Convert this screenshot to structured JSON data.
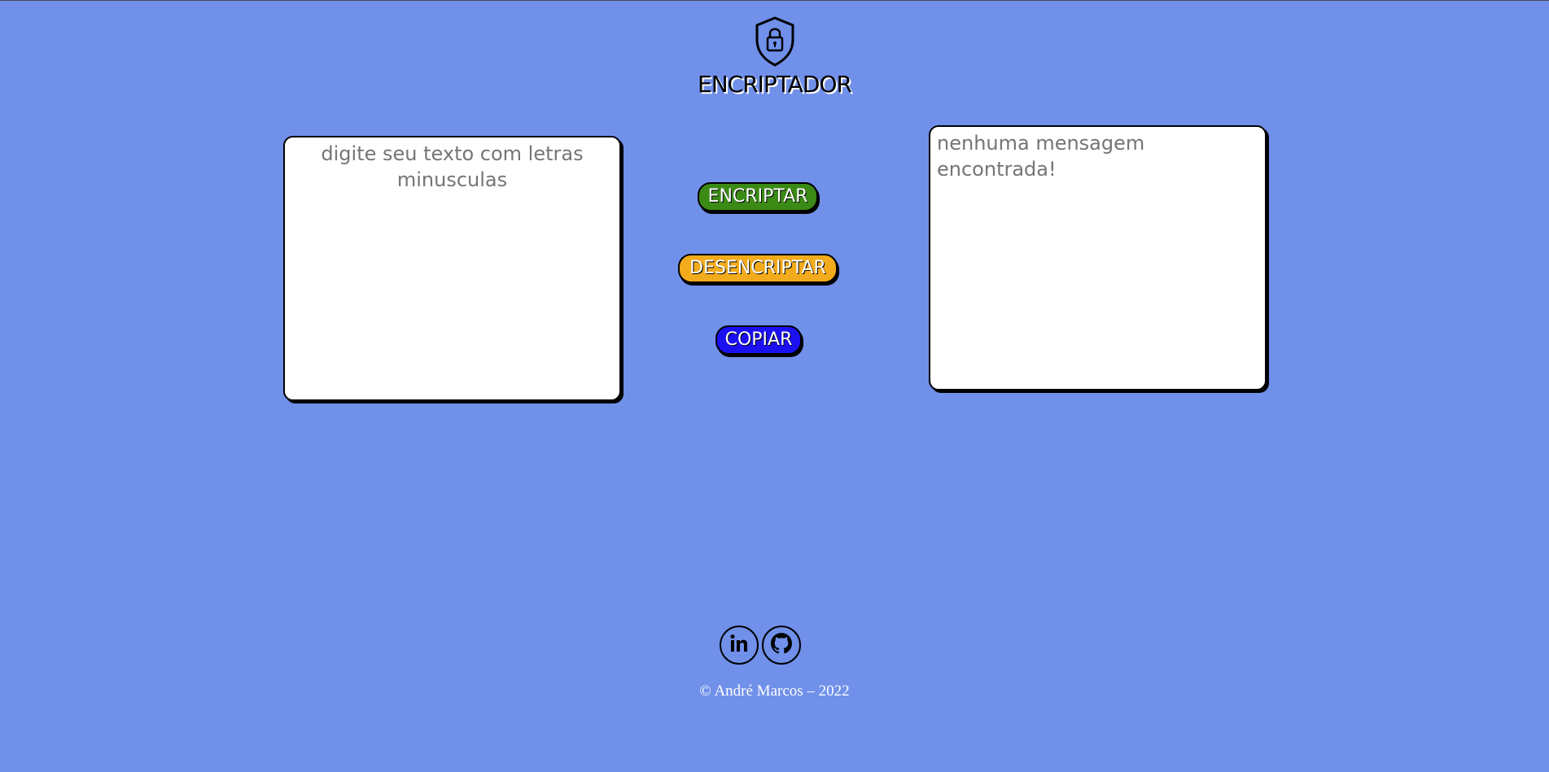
{
  "header": {
    "logo_icon": "shield-lock-icon",
    "title": "ENCRIPTADOR"
  },
  "input": {
    "placeholder": "digite seu texto com letras minusculas",
    "value": ""
  },
  "output": {
    "placeholder": "nenhuma mensagem encontrada!",
    "value": ""
  },
  "buttons": {
    "encrypt_label": "ENCRIPTAR",
    "decrypt_label": "DESENCRIPTAR",
    "copy_label": "COPIAR"
  },
  "social": {
    "linkedin_icon": "linkedin-icon",
    "github_icon": "github-icon"
  },
  "footer": {
    "copyright": "© André Marcos – 2022"
  },
  "colors": {
    "background": "#7090ea",
    "encrypt": "#3b8a16",
    "decrypt": "#f2ab1c",
    "copy": "#1b10f0"
  }
}
